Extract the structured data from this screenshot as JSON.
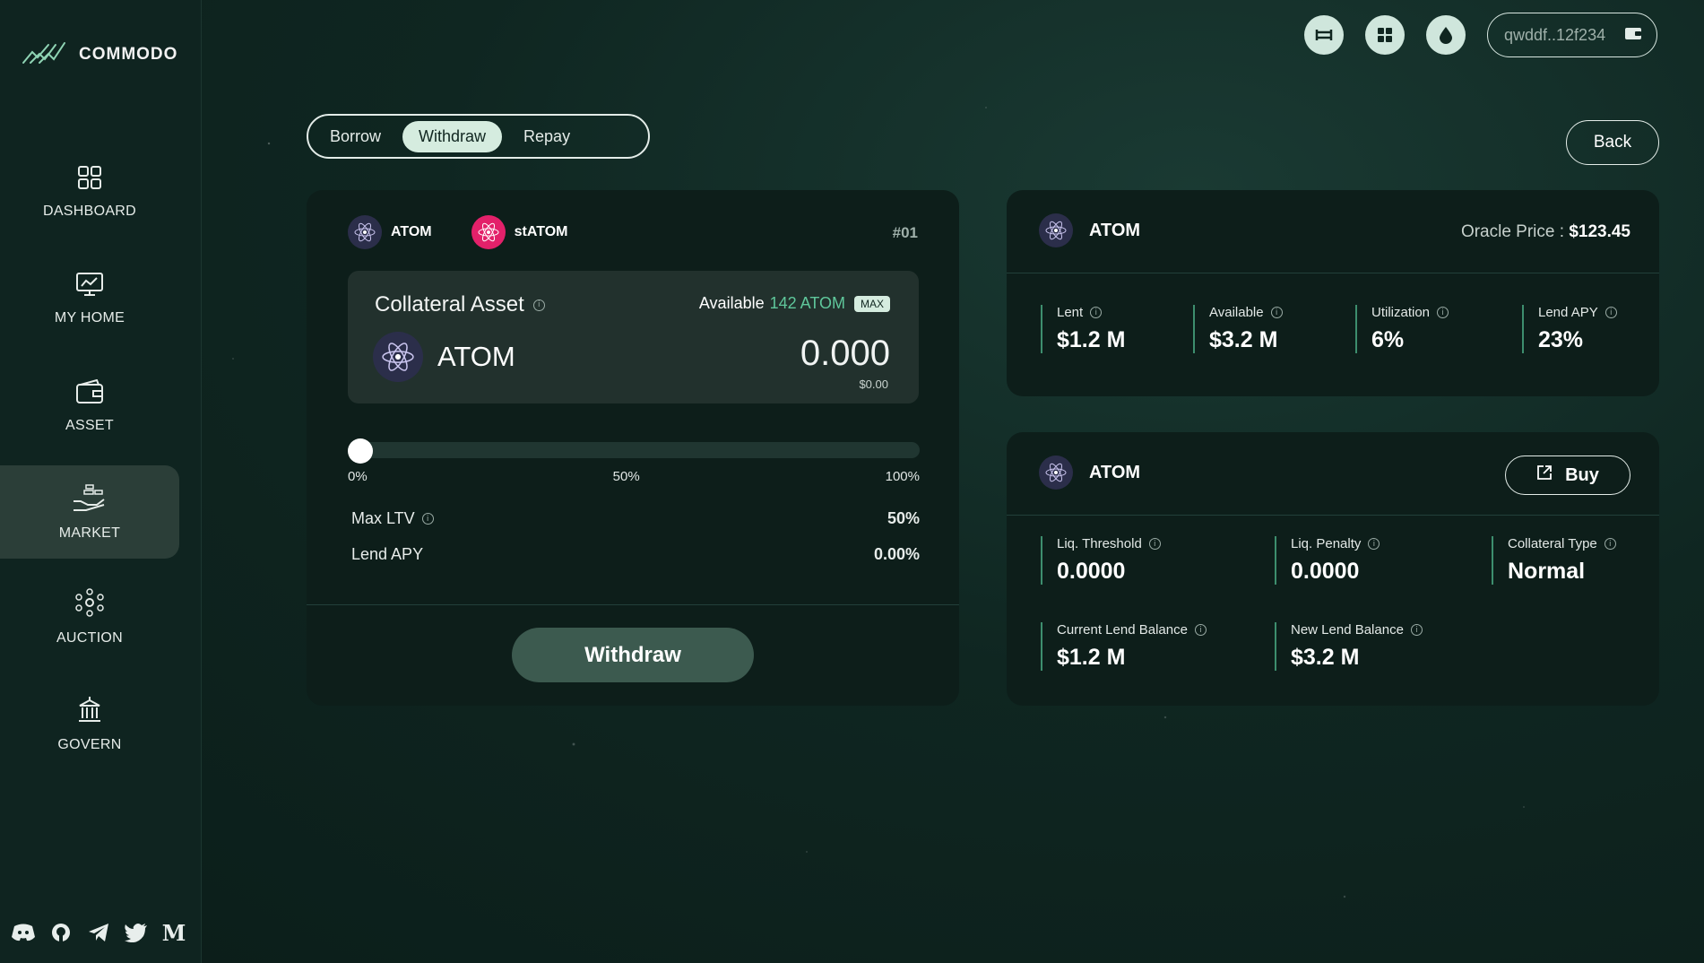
{
  "app": {
    "name": "COMMODO"
  },
  "nav": [
    {
      "label": "DASHBOARD",
      "icon": "dashboard-icon"
    },
    {
      "label": "MY HOME",
      "icon": "monitor-chart-icon"
    },
    {
      "label": "ASSET",
      "icon": "wallet-icon"
    },
    {
      "label": "MARKET",
      "icon": "market-icon",
      "active": true
    },
    {
      "label": "AUCTION",
      "icon": "auction-icon"
    },
    {
      "label": "GOVERN",
      "icon": "bank-icon"
    }
  ],
  "social": [
    "discord-icon",
    "github-icon",
    "telegram-icon",
    "twitter-icon",
    "medium-icon"
  ],
  "header": {
    "wallet_address": "qwddf..12f234"
  },
  "tabs": {
    "borrow": "Borrow",
    "withdraw": "Withdraw",
    "repay": "Repay"
  },
  "back_label": "Back",
  "pool": {
    "asset1": "ATOM",
    "asset2": "stATOM",
    "id": "#01",
    "collateral_title": "Collateral Asset",
    "available_label": "Available",
    "available_value": "142 ATOM",
    "max_label": "MAX",
    "asset_name": "ATOM",
    "amount": "0.000",
    "amount_usd": "$0.00",
    "slider_value": 0,
    "slider_labels": [
      "0%",
      "50%",
      "100%"
    ],
    "max_ltv_label": "Max LTV",
    "max_ltv_value": "50%",
    "lend_apy_label": "Lend APY",
    "lend_apy_value": "0.00%",
    "action_label": "Withdraw"
  },
  "market_card": {
    "asset": "ATOM",
    "oracle_label": "Oracle Price :",
    "oracle_value": "$123.45",
    "stats": [
      {
        "label": "Lent",
        "value": "$1.2 M"
      },
      {
        "label": "Available",
        "value": "$3.2 M"
      },
      {
        "label": "Utilization",
        "value": "6%"
      },
      {
        "label": "Lend APY",
        "value": "23%"
      }
    ]
  },
  "position_card": {
    "asset": "ATOM",
    "buy_label": "Buy",
    "stats": [
      {
        "label": "Liq. Threshold",
        "value": "0.0000"
      },
      {
        "label": "Liq. Penalty",
        "value": "0.0000"
      },
      {
        "label": "Collateral Type",
        "value": "Normal"
      },
      {
        "label": "Current Lend Balance",
        "value": "$1.2 M"
      },
      {
        "label": "New Lend Balance",
        "value": "$3.2 M"
      }
    ]
  },
  "colors": {
    "accent": "#5fc79b",
    "brand_bg": "#0f2420",
    "statom": "#e3216a"
  }
}
